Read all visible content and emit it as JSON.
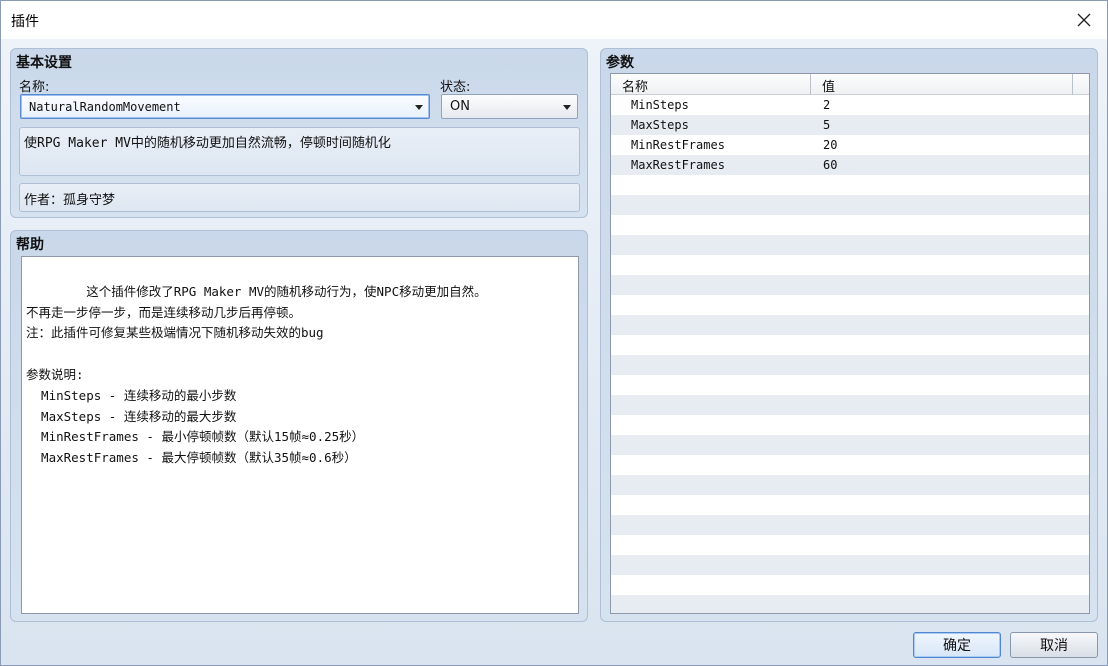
{
  "window": {
    "title": "插件",
    "close_icon": "close-icon"
  },
  "basic": {
    "section_title": "基本设置",
    "name_label": "名称:",
    "name_value": "NaturalRandomMovement",
    "status_label": "状态:",
    "status_value": "ON",
    "description": "使RPG Maker MV中的随机移动更加自然流畅，停顿时间随机化",
    "author": "作者：孤身守梦"
  },
  "help": {
    "section_title": "帮助",
    "text": "这个插件修改了RPG Maker MV的随机移动行为，使NPC移动更加自然。\n不再走一步停一步，而是连续移动几步后再停顿。\n注：此插件可修复某些极端情况下随机移动失效的bug\n\n参数说明:\n  MinSteps - 连续移动的最小步数\n  MaxSteps - 连续移动的最大步数\n  MinRestFrames - 最小停顿帧数（默认15帧≈0.25秒）\n  MaxRestFrames - 最大停顿帧数（默认35帧≈0.6秒）"
  },
  "params": {
    "section_title": "参数",
    "columns": [
      "名称",
      "值"
    ],
    "rows": [
      {
        "name": "MinSteps",
        "value": "2"
      },
      {
        "name": "MaxSteps",
        "value": "5"
      },
      {
        "name": "MinRestFrames",
        "value": "20"
      },
      {
        "name": "MaxRestFrames",
        "value": "60"
      }
    ]
  },
  "footer": {
    "ok_label": "确定",
    "cancel_label": "取消"
  },
  "colors": {
    "accent": "#4f86cf",
    "panel_bg": "#c9d8ea"
  }
}
